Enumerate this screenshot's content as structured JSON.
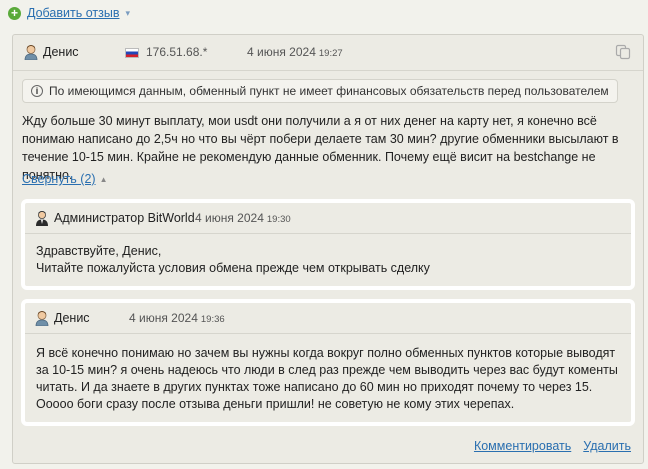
{
  "add_review": {
    "label": "Добавить отзыв",
    "icon": "plus-icon",
    "chevron": "▾"
  },
  "review": {
    "author": "Денис",
    "country": "RU",
    "ip": "176.51.68.*",
    "date": "4 июня 2024",
    "time": "19:27",
    "notice": "По имеющимся данным, обменный пункт не имеет финансовых обязательств перед пользователем",
    "text": "Жду больше 30 минут выплату, мои usdt они получили а я от них денег на карту нет, я конечно всё понимаю написано до 2,5ч но что вы чёрт побери делаете там 30 мин? другие обменники высылают в течение 10-15 мин. Крайне не рекомендую данные обменник. Почему ещё висит на bestchange не понятно.",
    "collapse_label": "Свернуть (2)"
  },
  "replies": [
    {
      "author": "Администратор BitWorld",
      "date": "4 июня 2024",
      "time": "19:30",
      "lines": [
        "Здравствуйте, Денис,",
        "Читайте пожалуйста условия обмена прежде чем открывать сделку"
      ]
    },
    {
      "author": "Денис",
      "date": "4 июня 2024",
      "time": "19:36",
      "lines": [
        "Я всё конечно понимаю но зачем вы нужны когда вокруг полно обменных пунктов которые выводят за 10-15 мин? я очень надеюсь что люди в след раз прежде чем выводить через вас будут коменты читать. И да знаете в других пунктах тоже написано до 60 мин но приходят почему то через 15. Ооооо боги сразу после отзыва деньги пришли! не советую не кому этих черепах."
      ]
    }
  ],
  "actions": {
    "comment": "Комментировать",
    "delete": "Удалить"
  }
}
